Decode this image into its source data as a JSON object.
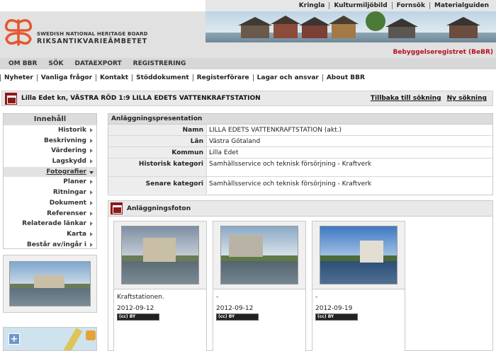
{
  "top_links": [
    "Kringla",
    "Kulturmiljöbild",
    "Fornsök",
    "Materialguiden"
  ],
  "logo": {
    "line1": "SWEDISH NATIONAL HERITAGE BOARD",
    "line2": "RIKSANTIKVARIEÄMBETET"
  },
  "register_name": "Bebyggelseregistret (BeBR)",
  "main_nav": [
    "OM BBR",
    "SÖK",
    "DATAEXPORT",
    "REGISTRERING"
  ],
  "sub_nav": [
    "Nyheter",
    "Vanliga frågor",
    "Kontakt",
    "Stöddokument",
    "Registerförare",
    "Lagar och ansvar",
    "About BBR"
  ],
  "title_bar": {
    "title": "Lilla Edet kn, VÄSTRA RÖD 1:9 LILLA EDETS VATTENKRAFTSTATION",
    "back_link": "Tillbaka till sökning",
    "new_search_link": "Ny sökning"
  },
  "sidebar": {
    "heading": "Innehåll",
    "items": [
      "Historik",
      "Beskrivning",
      "Värdering",
      "Lagskydd",
      "Fotografier",
      "Planer",
      "Ritningar",
      "Dokument",
      "Referenser",
      "Relaterade länkar",
      "Karta",
      "Består av/ingår i"
    ],
    "active_item": "Fotografier"
  },
  "presentation": {
    "heading": "Anläggningspresentation",
    "rows": [
      {
        "label": "Namn",
        "value": "LILLA EDETS VATTENKRAFTSTATION (akt.)"
      },
      {
        "label": "Län",
        "value": "Västra Götaland"
      },
      {
        "label": "Kommun",
        "value": "Lilla Edet"
      },
      {
        "label": "Historisk kategori",
        "value": "Samhällsservice och teknisk försörjning - Kraftverk"
      },
      {
        "label": "Senare kategori",
        "value": "Samhällsservice och teknisk försörjning - Kraftverk"
      }
    ]
  },
  "photos": {
    "heading": "Anläggningsfoton",
    "cards": [
      {
        "caption": "Kraftstationen.",
        "date": "2012-09-12",
        "license": "BY"
      },
      {
        "caption": "-",
        "date": "2012-09-12",
        "license": "BY"
      },
      {
        "caption": "-",
        "date": "2012-09-19",
        "license": "BY"
      }
    ]
  },
  "map": {
    "zoom_in": "+"
  }
}
